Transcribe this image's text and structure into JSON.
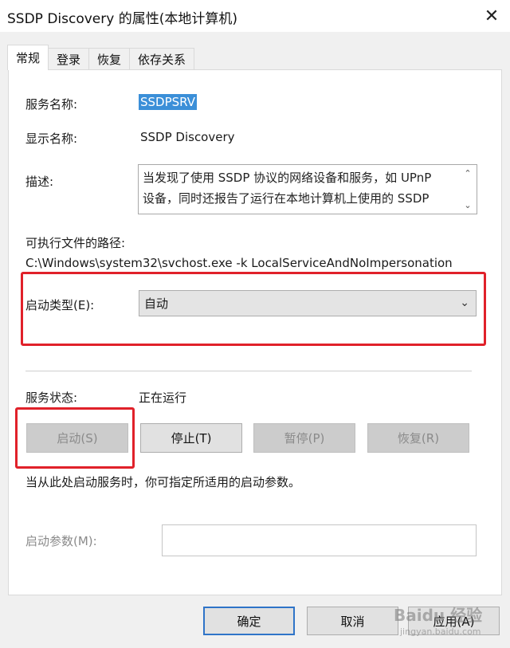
{
  "window": {
    "title": "SSDP Discovery 的属性(本地计算机)",
    "close_glyph": "✕"
  },
  "tabs": [
    {
      "label": "常规",
      "active": true
    },
    {
      "label": "登录",
      "active": false
    },
    {
      "label": "恢复",
      "active": false
    },
    {
      "label": "依存关系",
      "active": false
    }
  ],
  "general": {
    "service_name_label": "服务名称:",
    "service_name_value": "SSDPSRV",
    "display_name_label": "显示名称:",
    "display_name_value": "SSDP Discovery",
    "description_label": "描述:",
    "description_line1": "当发现了使用 SSDP 协议的网络设备和服务，如 UPnP",
    "description_line2": "设备，同时还报告了运行在本地计算机上使用的 SSDP",
    "path_label": "可执行文件的路径:",
    "path_value": "C:\\Windows\\system32\\svchost.exe -k LocalServiceAndNoImpersonation",
    "startup_type_label": "启动类型(E):",
    "startup_type_value": "自动",
    "status_label": "服务状态:",
    "status_value": "正在运行",
    "start_button": "启动(S)",
    "stop_button": "停止(T)",
    "pause_button": "暂停(P)",
    "resume_button": "恢复(R)",
    "hint_text": "当从此处启动服务时，你可指定所适用的启动参数。",
    "start_params_label": "启动参数(M):",
    "start_params_value": ""
  },
  "footer": {
    "ok_button": "确定",
    "cancel_button": "取消",
    "apply_button": "应用(A)"
  },
  "watermark": {
    "brand": "Baidu 经验",
    "url": "jingyan.baidu.com"
  },
  "colors": {
    "highlight_box": "#e0212a",
    "selection": "#3b8fd8",
    "default_button_border": "#2f74c8"
  }
}
